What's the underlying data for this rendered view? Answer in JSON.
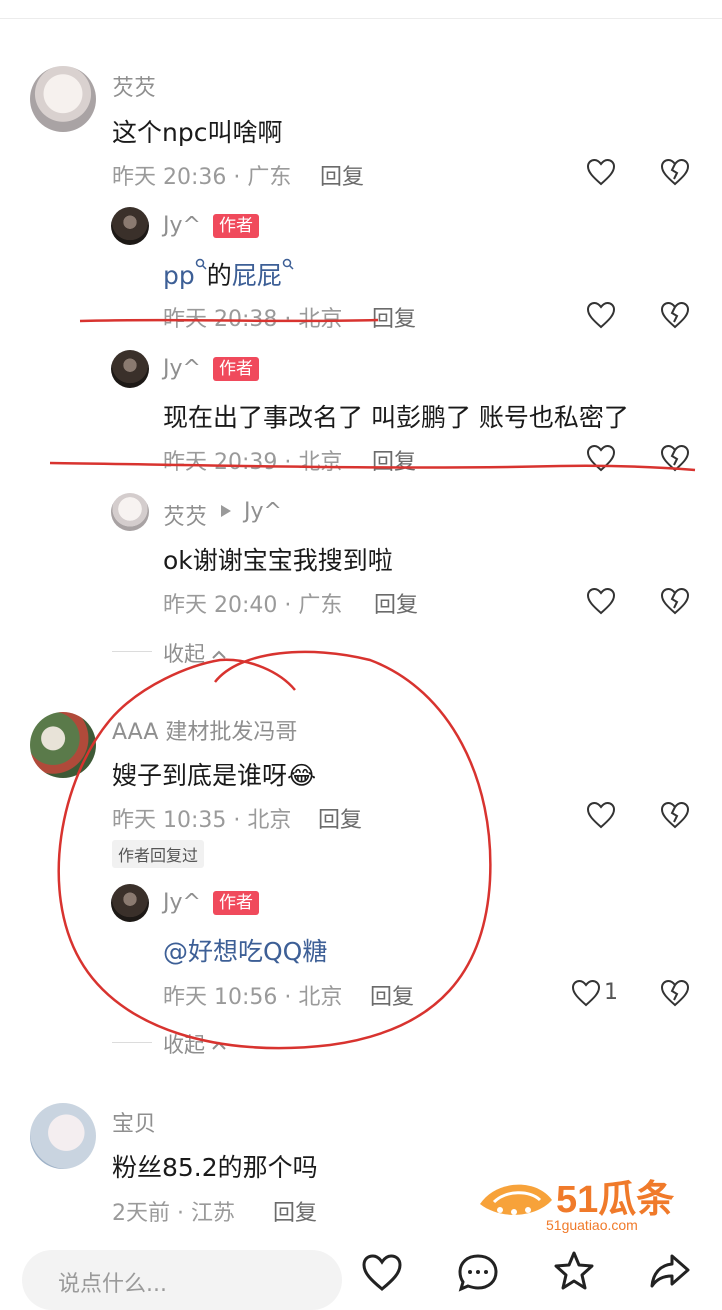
{
  "comments": [
    {
      "author": "芡芡",
      "text": "这个npc叫啥啊",
      "meta": "昨天 20:36 · 广东",
      "reply_label": "回复",
      "replies": [
        {
          "author": "Jy^",
          "badge": "作者",
          "text_part1": "pp",
          "text_part2": "的",
          "text_part3": "屁屁",
          "meta": "昨天 20:38 · 北京",
          "reply_label": "回复"
        },
        {
          "author": "Jy^",
          "badge": "作者",
          "text": "现在出了事改名了 叫彭鹏了 账号也私密了",
          "meta": "昨天 20:39 · 北京",
          "reply_label": "回复"
        },
        {
          "author": "芡芡",
          "reply_to": "Jy^",
          "text": "ok谢谢宝宝我搜到啦",
          "meta": "昨天 20:40 · 广东",
          "reply_label": "回复"
        }
      ],
      "collapse_label": "收起"
    },
    {
      "author": "AAA 建材批发冯哥",
      "text": "嫂子到底是谁呀",
      "emoji": "😂",
      "meta": "昨天 10:35 · 北京",
      "reply_label": "回复",
      "tag": "作者回复过",
      "replies": [
        {
          "author": "Jy^",
          "badge": "作者",
          "text": "@好想吃QQ糖",
          "meta": "昨天 10:56 · 北京",
          "reply_label": "回复",
          "likes": "1"
        }
      ],
      "collapse_label": "收起"
    },
    {
      "author": "宝贝",
      "text": "粉丝85.2的那个吗",
      "meta": "2天前 · 江苏",
      "reply_label": "回复"
    }
  ],
  "input": {
    "placeholder": "说点什么..."
  },
  "watermark": {
    "brand": "51瓜条",
    "url": "51guatiao.com"
  },
  "colors": {
    "badge": "#f04a5c",
    "link": "#3d5f96",
    "annotation": "#d8332f",
    "watermark": "#f07a2a"
  },
  "icons": [
    "heart-icon",
    "broken-heart-icon",
    "search-icon",
    "play-icon",
    "chevron-up-icon",
    "comment-icon",
    "star-icon",
    "share-icon"
  ]
}
